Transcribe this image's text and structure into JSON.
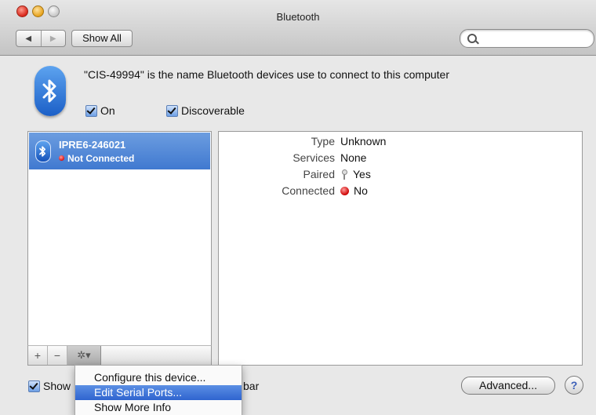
{
  "window": {
    "title": "Bluetooth"
  },
  "toolbar": {
    "back_label": "◀",
    "forward_label": "▶",
    "show_all_label": "Show All",
    "search_placeholder": ""
  },
  "header": {
    "message": "\"CIS-49994\" is the name Bluetooth devices use to connect to this computer",
    "on_label": "On",
    "discoverable_label": "Discoverable"
  },
  "devices": [
    {
      "name": "IPRE6-246021",
      "status": "Not Connected"
    }
  ],
  "list_toolbar": {
    "add_label": "+",
    "remove_label": "−",
    "gear_label": "✲▾"
  },
  "details": [
    {
      "label": "Type",
      "value": "Unknown",
      "icon": ""
    },
    {
      "label": "Services",
      "value": "None",
      "icon": ""
    },
    {
      "label": "Paired",
      "value": "Yes",
      "icon": "key-icon"
    },
    {
      "label": "Connected",
      "value": "No",
      "icon": "red-dot-icon"
    }
  ],
  "footer": {
    "show_label": "Show",
    "show_suffix": "bar",
    "advanced_label": "Advanced...",
    "help_label": "?"
  },
  "context_menu": {
    "items": [
      {
        "label": "Configure this device..."
      },
      {
        "label": "Edit Serial Ports..."
      },
      {
        "label": "Show More Info"
      }
    ],
    "selected_index": 1
  },
  "colors": {
    "selection": "#4079d0",
    "accent": "#2f64cf"
  }
}
